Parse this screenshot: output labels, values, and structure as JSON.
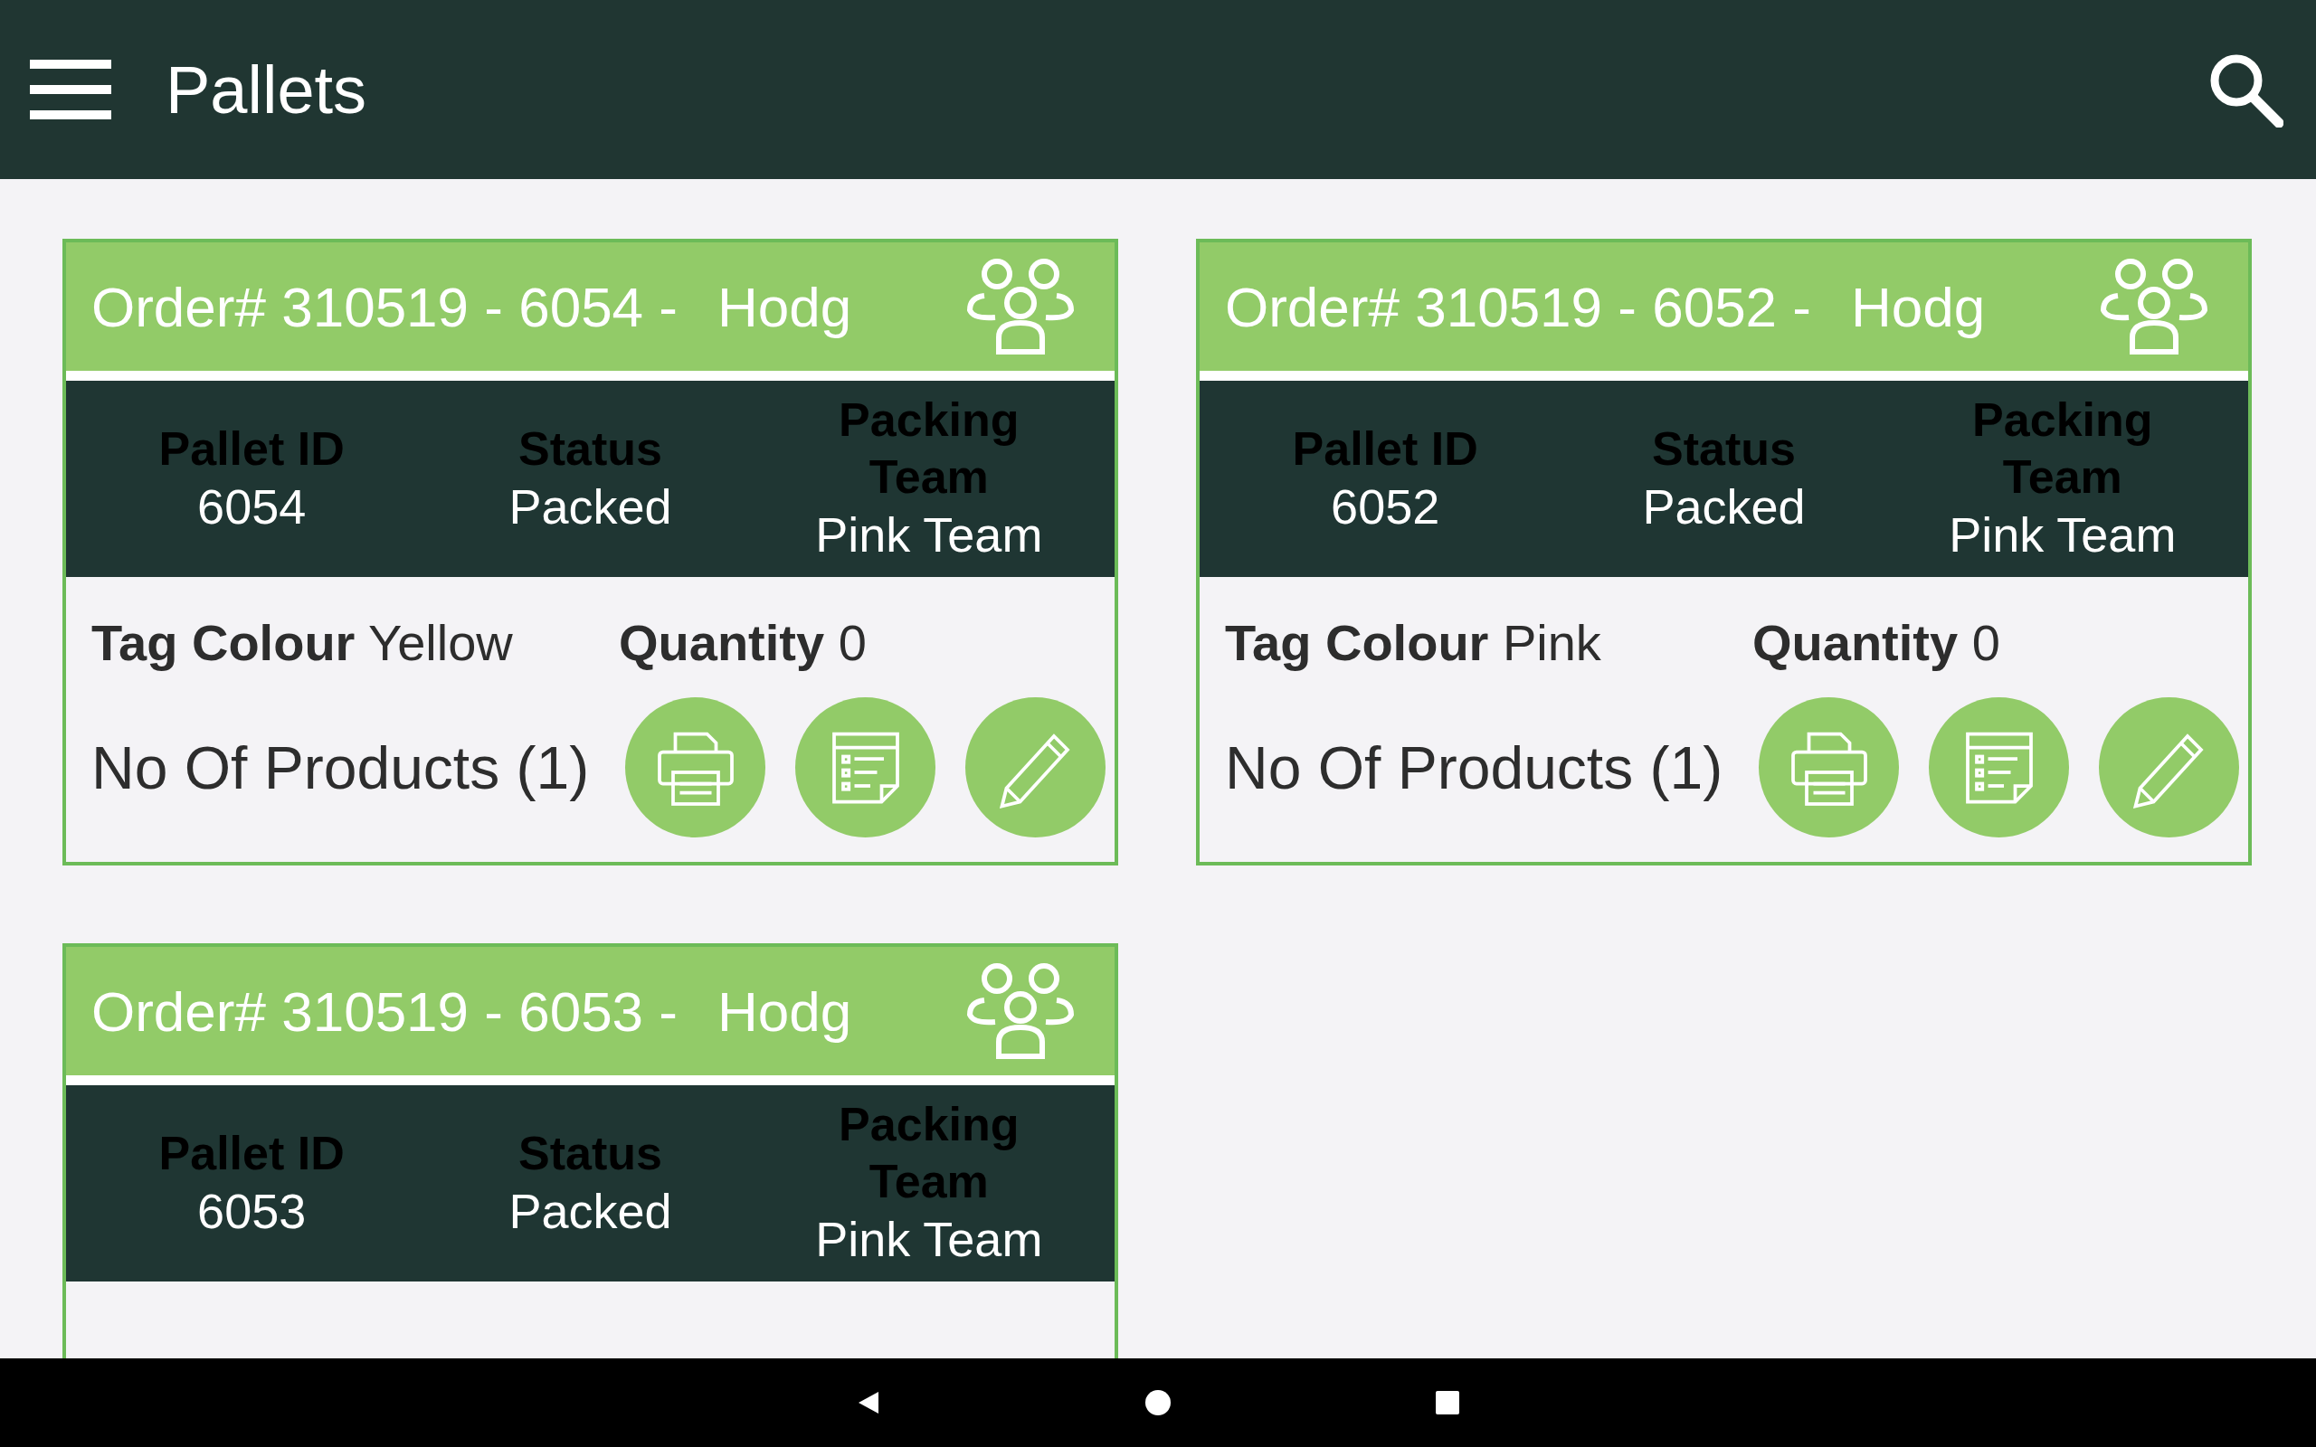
{
  "app_bar": {
    "title": "Pallets"
  },
  "pallets": [
    {
      "order": "Order# 310519 - 6054 -",
      "customer": "Hodg",
      "fields": [
        {
          "label": "Pallet ID",
          "value": "6054"
        },
        {
          "label": "Status",
          "value": "Packed"
        },
        {
          "label": "Packing Team",
          "value": "Pink Team"
        }
      ],
      "tag_colour": {
        "label": "Tag Colour",
        "value": "Yellow"
      },
      "quantity": {
        "label": "Quantity",
        "value": "0"
      },
      "products": "No Of Products (1)",
      "actions": [
        {
          "kind": "print"
        },
        {
          "kind": "notes"
        },
        {
          "kind": "edit"
        }
      ]
    },
    {
      "order": "Order# 310519 - 6052 -",
      "customer": "Hodg",
      "fields": [
        {
          "label": "Pallet ID",
          "value": "6052"
        },
        {
          "label": "Status",
          "value": "Packed"
        },
        {
          "label": "Packing Team",
          "value": "Pink Team"
        }
      ],
      "tag_colour": {
        "label": "Tag Colour",
        "value": "Pink"
      },
      "quantity": {
        "label": "Quantity",
        "value": "0"
      },
      "products": "No Of Products (1)",
      "actions": [
        {
          "kind": "print"
        },
        {
          "kind": "notes"
        },
        {
          "kind": "edit"
        }
      ]
    },
    {
      "order": "Order# 310519 - 6053 -",
      "customer": "Hodg",
      "fields": [
        {
          "label": "Pallet ID",
          "value": "6053"
        },
        {
          "label": "Status",
          "value": "Packed"
        },
        {
          "label": "Packing Team",
          "value": "Pink Team"
        }
      ]
    }
  ]
}
